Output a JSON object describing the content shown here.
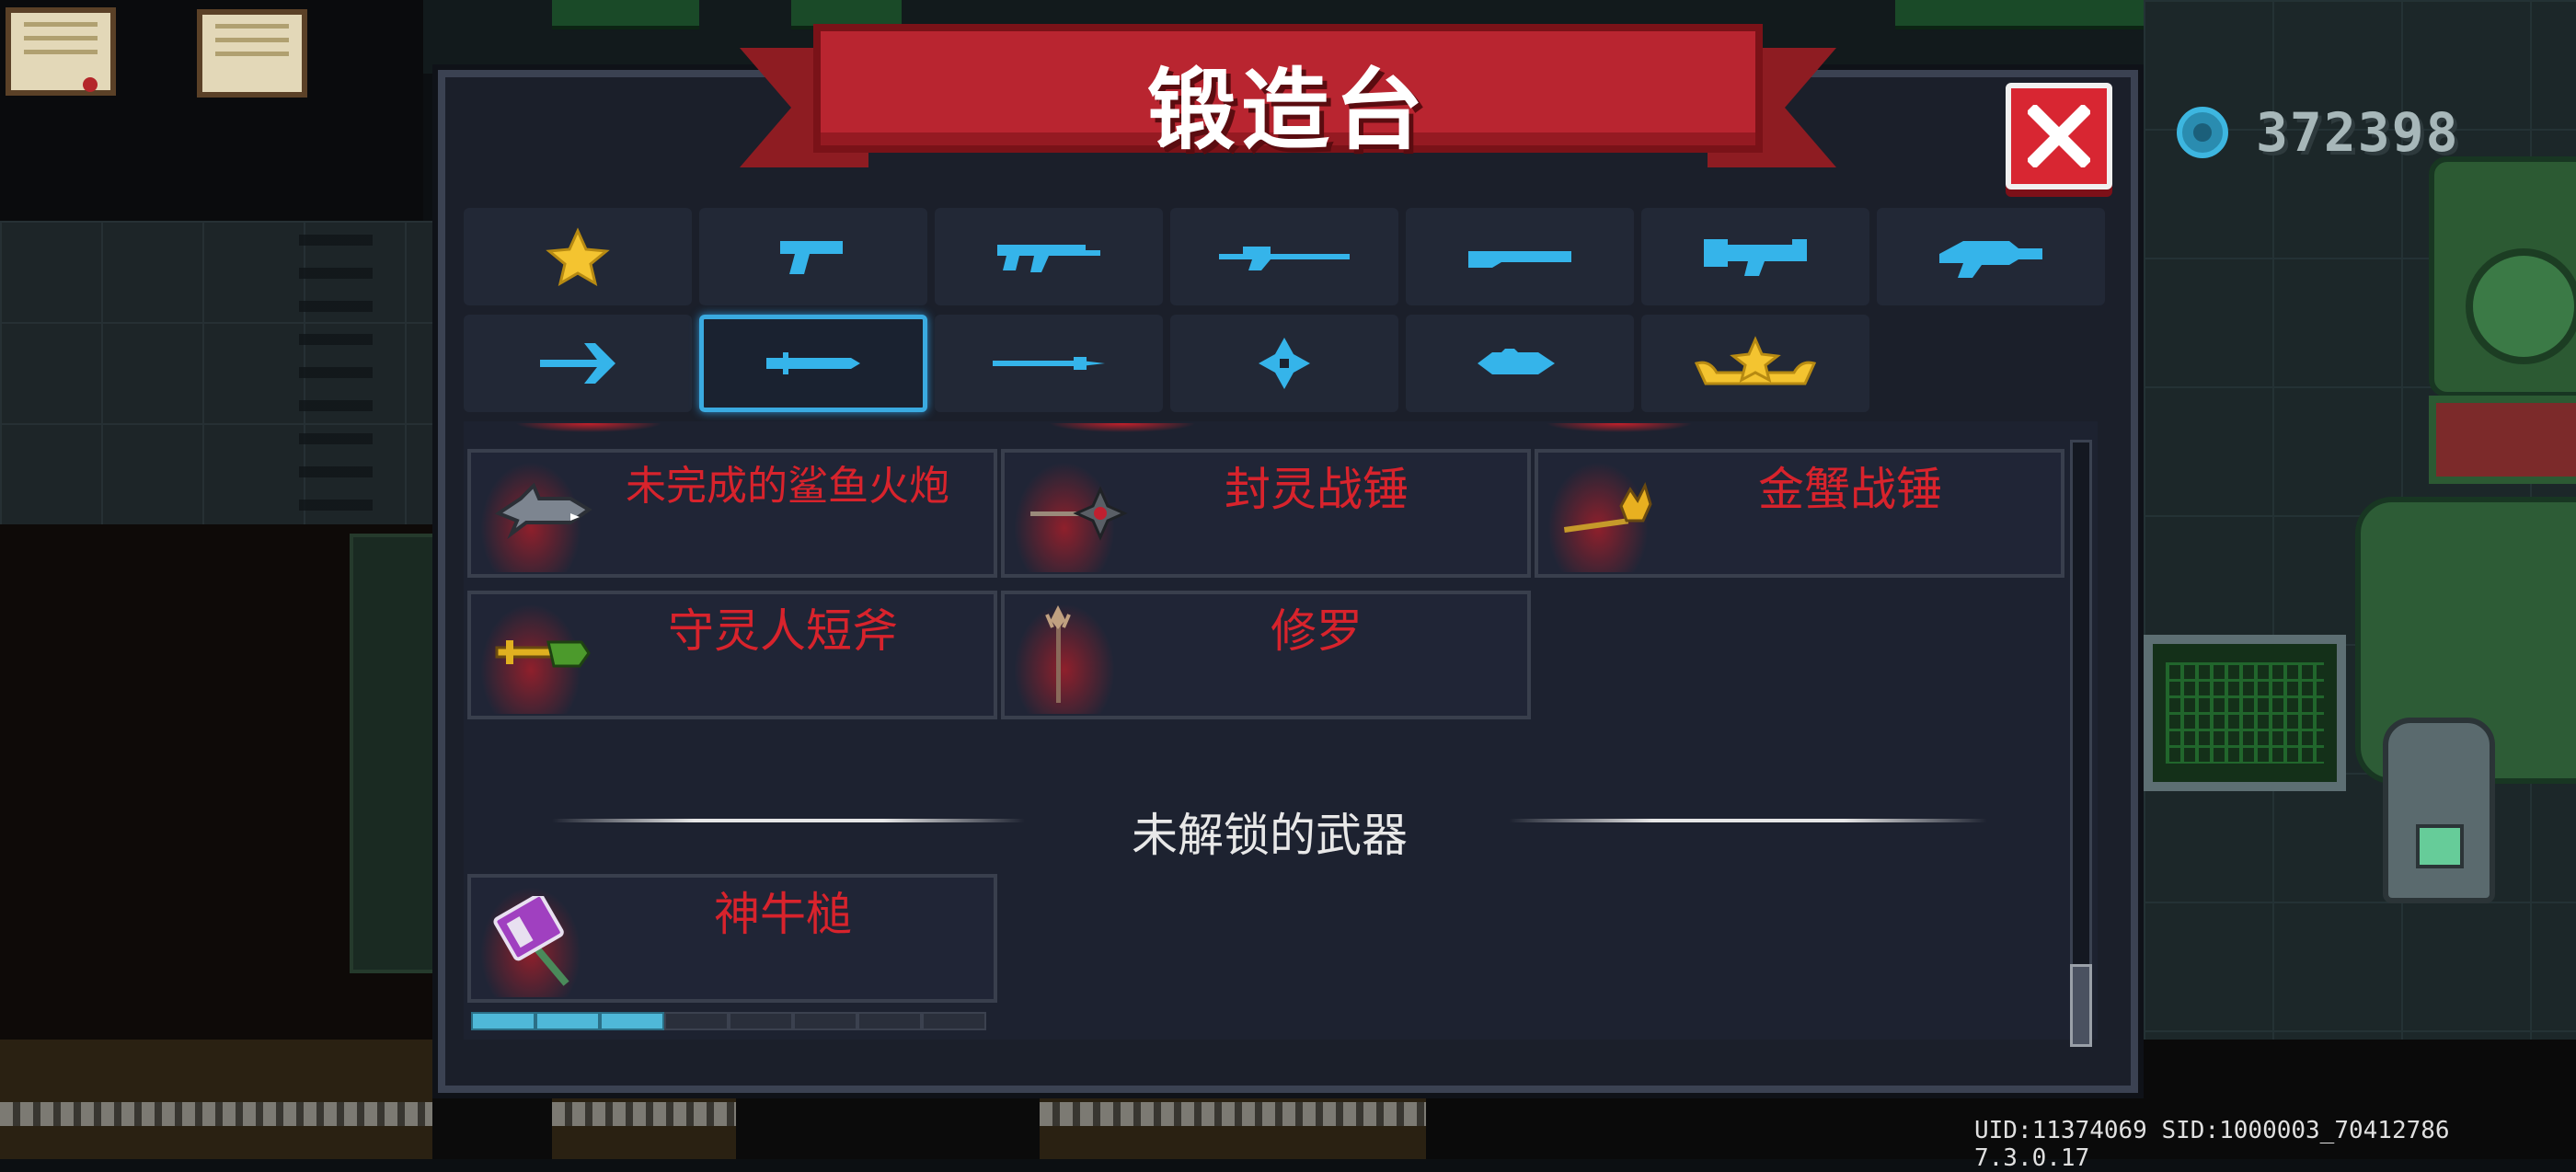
{
  "header": {
    "title": "锻造台"
  },
  "currency": {
    "amount": "372398",
    "icon": "gem-coin-icon"
  },
  "close": {
    "icon": "close-x-icon"
  },
  "category_tabs": [
    {
      "icon": "star-icon",
      "color": "#f4c430"
    },
    {
      "icon": "pistol-icon",
      "color": "#35b4ea"
    },
    {
      "icon": "assault-rifle-icon",
      "color": "#35b4ea"
    },
    {
      "icon": "sniper-rifle-icon",
      "color": "#35b4ea"
    },
    {
      "icon": "shotgun-icon",
      "color": "#35b4ea"
    },
    {
      "icon": "launcher-icon",
      "color": "#35b4ea"
    },
    {
      "icon": "laser-gun-icon",
      "color": "#35b4ea"
    },
    {
      "icon": "bow-icon",
      "color": "#35b4ea"
    },
    {
      "icon": "sword-icon",
      "color": "#35b4ea",
      "selected": true
    },
    {
      "icon": "spear-icon",
      "color": "#35b4ea"
    },
    {
      "icon": "shuriken-icon",
      "color": "#35b4ea"
    },
    {
      "icon": "fish-icon",
      "color": "#35b4ea"
    },
    {
      "icon": "crown-icon",
      "color": "#f4c430"
    }
  ],
  "weapons": [
    {
      "name": "未完成的鲨鱼火炮",
      "icon": "shark-cannon-icon"
    },
    {
      "name": "封灵战锤",
      "icon": "seal-hammer-icon"
    },
    {
      "name": "金蟹战锤",
      "icon": "crab-hammer-icon"
    },
    {
      "name": "守灵人短斧",
      "icon": "keeper-axe-icon"
    },
    {
      "name": "修罗",
      "icon": "asura-staff-icon"
    }
  ],
  "locked_section": {
    "title": "未解锁的武器"
  },
  "locked_weapons": [
    {
      "name": "神牛槌",
      "icon": "bull-mallet-icon"
    }
  ],
  "pager": {
    "current": 3,
    "total": 8
  },
  "meta": {
    "build_info": "UID:11374069 SID:1000003_70412786 7.3.0.17"
  },
  "colors": {
    "accent_blue": "#35b4ea",
    "weapon_label": "#d8232c",
    "banner": "#b92530"
  }
}
